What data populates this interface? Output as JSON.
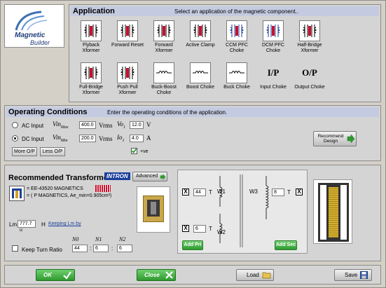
{
  "logo": {
    "line1": "Magnetic",
    "line2": "Builder"
  },
  "application": {
    "title": "Application",
    "hint": "Select an application of the magnetic component..",
    "items": [
      {
        "label": "Flyback Xformer"
      },
      {
        "label": "Forward Reset"
      },
      {
        "label": "Forward Xformer"
      },
      {
        "label": "Active Clamp"
      },
      {
        "label": "CCM PFC Choke"
      },
      {
        "label": "DCM PFC Choke"
      },
      {
        "label": "Half-Bridge Xformer"
      },
      {
        "label": "Full-Bridge Xformer"
      },
      {
        "label": "Push Pull Xformer"
      },
      {
        "label": "Buck-Boost Choke"
      },
      {
        "label": "Boost Choke"
      },
      {
        "label": "Buck Choke"
      },
      {
        "label": "Input Choke",
        "glyph": "I/P"
      },
      {
        "label": "Output Choke",
        "glyph": "O/P"
      }
    ]
  },
  "operating": {
    "title": "Operating Conditions",
    "hint": "Enter the operating conditions of the application.",
    "ac_label": "AC Input",
    "dc_label": "DC Input",
    "vin_max_sym": "Vin",
    "vin_max_sub": "Max",
    "vin_max_value": "400.0",
    "vin_max_unit": "Vrms",
    "vin_min_sym": "Vin",
    "vin_min_sub": "Min",
    "vin_min_value": "200.0",
    "vin_min_unit": "Vrms",
    "vo_sym": "Vo",
    "vo_sub": "1",
    "vo_value": "12.0",
    "vo_unit": "V",
    "io_sym": "Io",
    "io_sub": "1",
    "io_value": "4.0",
    "io_unit": "A",
    "ve_label": "+ve",
    "more_op": "More O/P",
    "less_op": "Less O/P",
    "recommend_label": "Recommend Design"
  },
  "transformer": {
    "title": "Recommended Transformer",
    "brand": "INTRON",
    "advanced": "Advanced",
    "core_name": "EE-43520 MAGNETICS",
    "core_desc": "( P MAGNETICS, Ae_min=0.905cm²)",
    "lm_label": "Lm",
    "lm_value": "777.7 u",
    "lm_unit": "H",
    "keeping_link": "Keeping Lm by",
    "keep_turn_label": "Keep Turn Ratio",
    "n0_label": "N0",
    "n1_label": "N1",
    "n2_label": "N2",
    "n0_value": "44",
    "n1_value": "6",
    "n2_value": "6",
    "w1_turns": "44",
    "w2_turns": "6",
    "w3_turns": "8",
    "w1_label": "W1",
    "w2_label": "W2",
    "w3_label": "W3",
    "t_unit": "T",
    "add_pri": "Add Pri",
    "add_sec": "Add Sec"
  },
  "footer": {
    "ok": "OK",
    "close": "Close",
    "load": "Load",
    "save": "Save"
  }
}
